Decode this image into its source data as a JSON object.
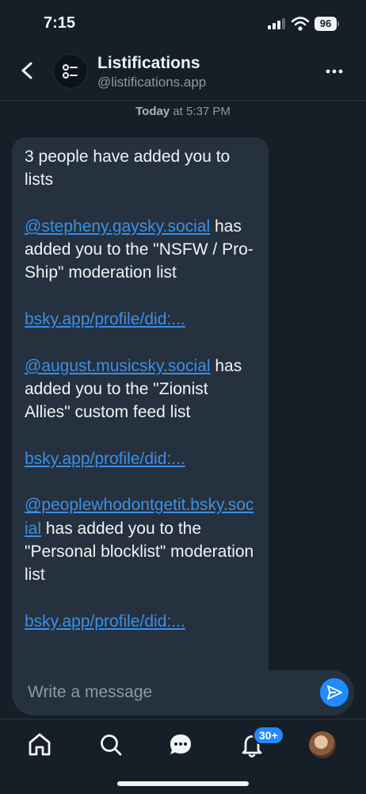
{
  "status_bar": {
    "time": "7:15",
    "battery": "96"
  },
  "header": {
    "title": "Listifications",
    "handle": "@listifications.app"
  },
  "timestamp": {
    "day": "Today",
    "rest": "at 5:37 PM"
  },
  "message": {
    "intro": "3 people have added you to lists",
    "entries": [
      {
        "mention": "@stepheny.gaysky.social",
        "text": "has added you to the \"NSFW / Pro-Ship\" moderation list",
        "link": "bsky.app/profile/did:..."
      },
      {
        "mention": "@august.musicsky.social",
        "text": "has added you to the \"Zionist Allies\" custom feed list",
        "link": "bsky.app/profile/did:..."
      },
      {
        "mention": "@peoplewhodontgetit.bsky.social",
        "text": "has added you to the \"Personal blocklist\" moderation list",
        "link": "bsky.app/profile/did:..."
      }
    ]
  },
  "composer": {
    "placeholder": "Write a message"
  },
  "tab_bar": {
    "notifications_badge": "30+"
  },
  "icons": [
    "back-icon",
    "list-icon",
    "more-icon",
    "send-icon",
    "home-icon",
    "search-icon",
    "chat-icon",
    "bell-icon"
  ],
  "colors": {
    "background": "#161e27",
    "bubble": "#25313e",
    "link": "#3c8fe8",
    "accent": "#208bfe"
  }
}
